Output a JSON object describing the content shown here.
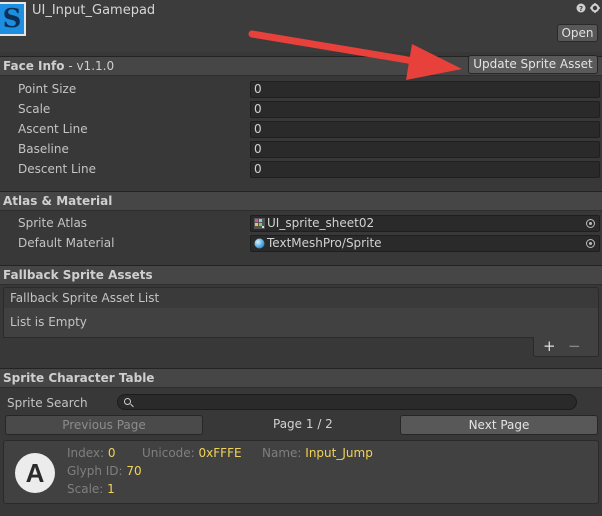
{
  "header": {
    "asset_title": "UI_Input_Gamepad",
    "help_icon": "question-icon",
    "settings_icon": "gear-icon",
    "open_label": "Open",
    "logo_letter": "S"
  },
  "face_info": {
    "title": "Face Info",
    "version": " - v1.1.0",
    "update_label": "Update Sprite Asset",
    "fields": [
      {
        "label": "Point Size",
        "value": "0"
      },
      {
        "label": "Scale",
        "value": "0"
      },
      {
        "label": "Ascent Line",
        "value": "0"
      },
      {
        "label": "Baseline",
        "value": "0"
      },
      {
        "label": "Descent Line",
        "value": "0"
      }
    ]
  },
  "atlas": {
    "title": "Atlas & Material",
    "sprite_atlas_label": "Sprite Atlas",
    "sprite_atlas_value": "UI_sprite_sheet02",
    "default_material_label": "Default Material",
    "default_material_value": "TextMeshPro/Sprite"
  },
  "fallback": {
    "title": "Fallback Sprite Assets",
    "list_header": "Fallback Sprite Asset List",
    "empty_text": "List is Empty",
    "add_label": "+",
    "remove_label": "−"
  },
  "char_table": {
    "title": "Sprite Character Table",
    "search_label": "Sprite Search",
    "prev_label": "Previous Page",
    "page_text": "Page 1 / 2",
    "next_label": "Next Page",
    "card": {
      "glyph": "A",
      "index_label": "Index:",
      "index_value": "0",
      "unicode_label": "Unicode:",
      "unicode_value": "0xFFFE",
      "name_label": "Name:",
      "name_value": "Input_Jump",
      "glyph_id_label": "Glyph ID:",
      "glyph_id_value": "70",
      "scale_label": "Scale:",
      "scale_value": "1"
    }
  },
  "colors": {
    "background": "#383838",
    "section_header": "#464646",
    "field_bg": "#2a2a2a",
    "logo_blue": "#1e8fe0",
    "arrow_red": "#e8403a",
    "highlight_yellow": "#f0d35a"
  }
}
